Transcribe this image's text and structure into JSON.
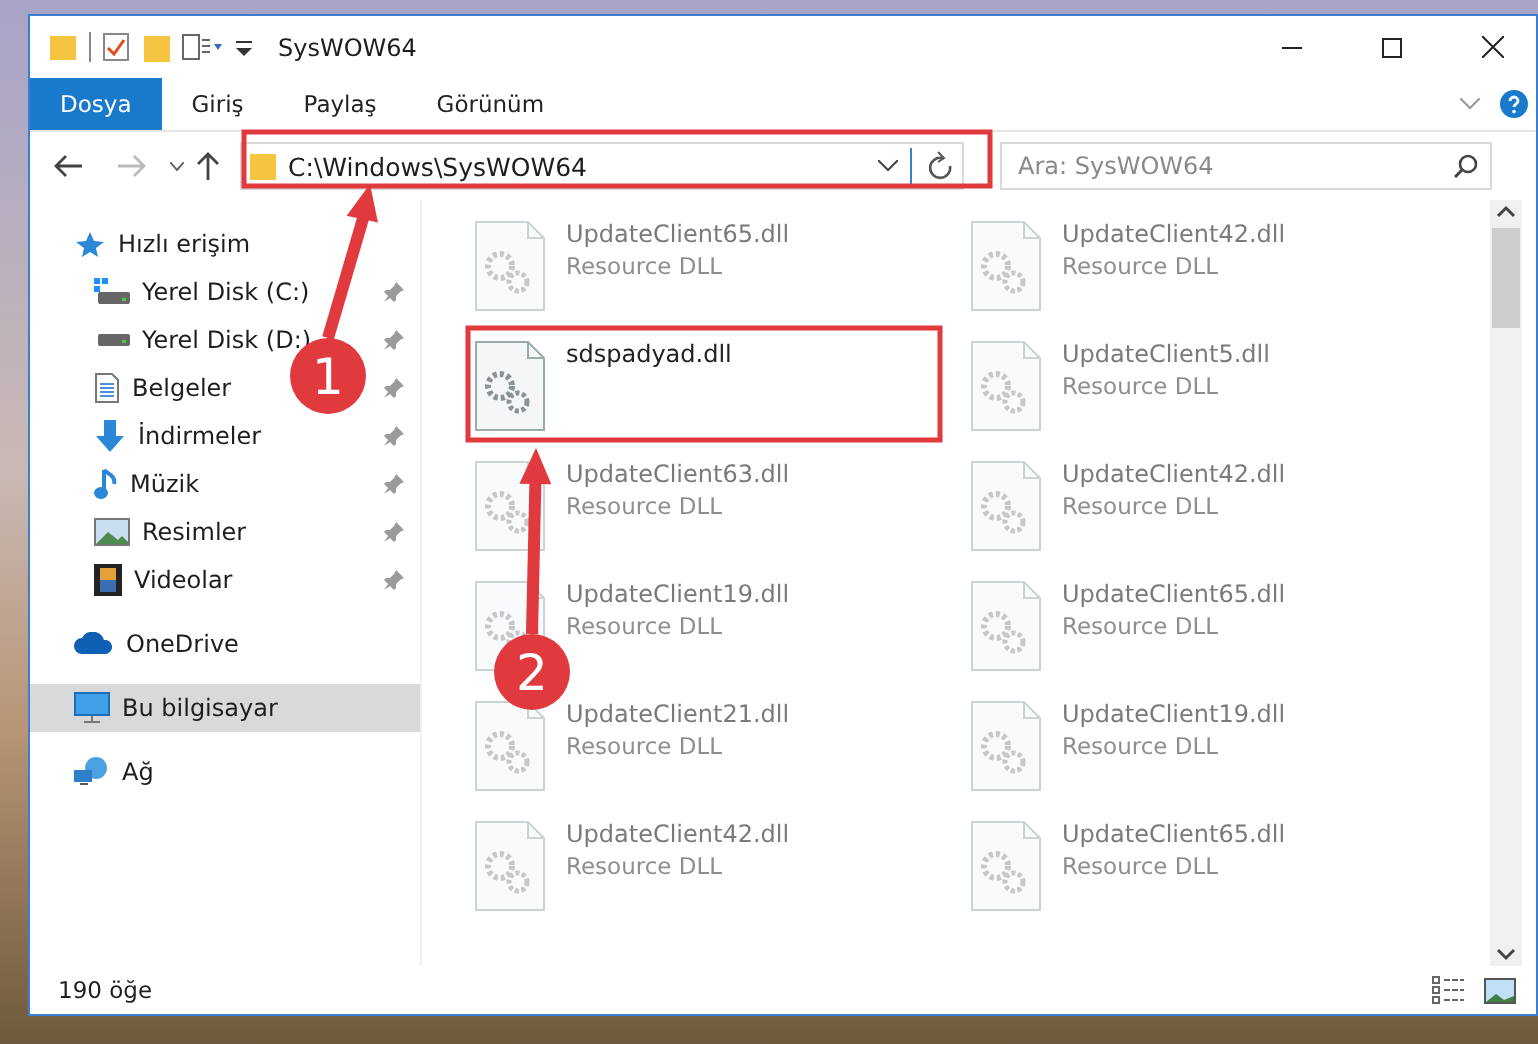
{
  "window": {
    "title": "SysWOW64"
  },
  "ribbon_tabs": [
    {
      "label": "Dosya",
      "kind": "file"
    },
    {
      "label": "Giriş",
      "kind": "tab"
    },
    {
      "label": "Paylaş",
      "kind": "tab"
    },
    {
      "label": "Görünüm",
      "kind": "tab"
    }
  ],
  "address": {
    "path": "C:\\Windows\\SysWOW64"
  },
  "search": {
    "placeholder": "Ara: SysWOW64"
  },
  "sidebar": {
    "items": [
      {
        "label": "Hızlı erişim",
        "selected": false,
        "children": [
          {
            "label": "Yerel Disk (C:)",
            "pinned": true
          },
          {
            "label": "Yerel Disk (D:)",
            "pinned": true
          },
          {
            "label": "Belgeler",
            "pinned": true
          },
          {
            "label": "İndirmeler",
            "pinned": true
          },
          {
            "label": "Müzik",
            "pinned": true
          },
          {
            "label": "Resimler",
            "pinned": true
          },
          {
            "label": "Videolar",
            "pinned": true
          }
        ]
      },
      {
        "label": "OneDrive",
        "selected": false
      },
      {
        "label": "Bu bilgisayar",
        "selected": true
      },
      {
        "label": "Ağ",
        "selected": false
      }
    ]
  },
  "files": [
    {
      "name": "UpdateClient65.dll",
      "type": "Resource DLL",
      "faded": true
    },
    {
      "name": "UpdateClient42.dll",
      "type": "Resource DLL",
      "faded": true
    },
    {
      "name": "sdspadyad.dll",
      "faded": false
    },
    {
      "name": "UpdateClient5.dll",
      "type": "Resource DLL",
      "faded": true
    },
    {
      "name": "UpdateClient63.dll",
      "type": "Resource DLL",
      "faded": true
    },
    {
      "name": "UpdateClient42.dll",
      "type": "Resource DLL",
      "faded": true
    },
    {
      "name": "UpdateClient19.dll",
      "type": "Resource DLL",
      "faded": true
    },
    {
      "name": "UpdateClient65.dll",
      "type": "Resource DLL",
      "faded": true
    },
    {
      "name": "UpdateClient21.dll",
      "type": "Resource DLL",
      "faded": true
    },
    {
      "name": "UpdateClient19.dll",
      "type": "Resource DLL",
      "faded": true
    },
    {
      "name": "UpdateClient42.dll",
      "type": "Resource DLL",
      "faded": true
    },
    {
      "name": "UpdateClient65.dll",
      "type": "Resource DLL",
      "faded": true
    }
  ],
  "annotations": [
    {
      "label": "1"
    },
    {
      "label": "2"
    }
  ],
  "status_bar": {
    "count": "190 öğe"
  }
}
